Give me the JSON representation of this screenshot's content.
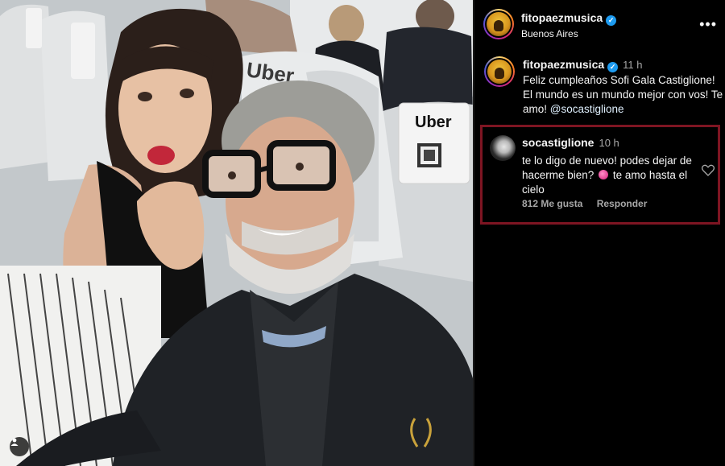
{
  "post": {
    "author": "fitopaezmusica",
    "location": "Buenos Aires",
    "more_label": "•••",
    "verified_mark": "✓"
  },
  "caption": {
    "author": "fitopaezmusica",
    "time": "11 h",
    "text": "Feliz cumpleaños Sofi Gala Castiglione! El mundo es un mundo mejor con vos! Te amo!",
    "mention": "@socastiglione"
  },
  "comment": {
    "author": "socastiglione",
    "time": "10 h",
    "text_before_emoji": "te lo digo de nuevo! podes dejar de hacerme bien?",
    "text_after_emoji": "te amo hasta el cielo",
    "likes": "812 Me gusta",
    "reply_label": "Responder"
  },
  "photo": {
    "seat_brand": "Uber",
    "card_brand": "Uber"
  },
  "colors": {
    "highlight_border": "#7e1522",
    "verified": "#1d9bf0",
    "muted_text": "#a8a8a8"
  },
  "icons": [
    "user-tag-icon",
    "more-options-icon",
    "verified-badge-icon",
    "heart-icon"
  ]
}
